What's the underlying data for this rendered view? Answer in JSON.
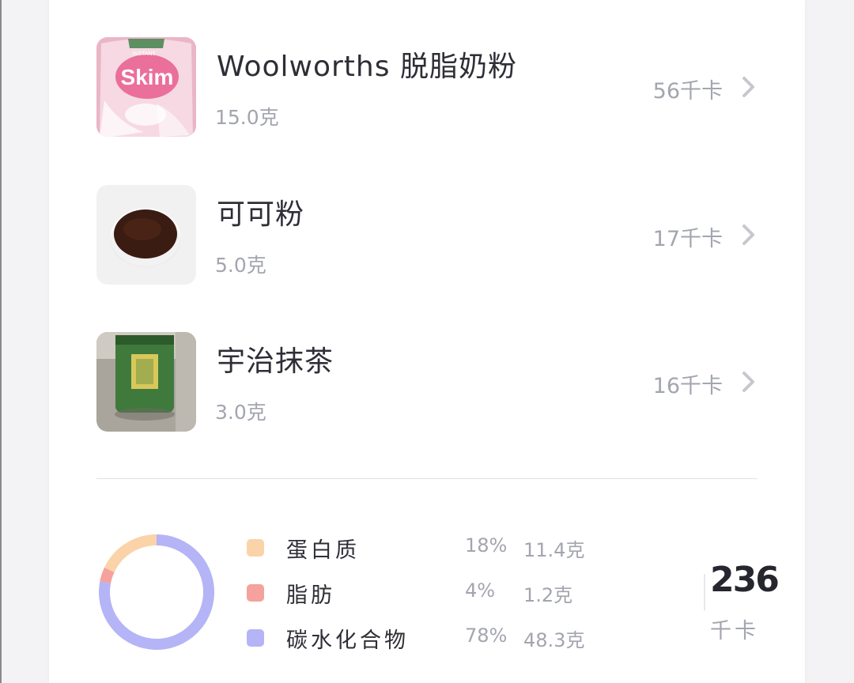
{
  "food_items": [
    {
      "name": "Woolworths 脱脂奶粉",
      "amount": "15.0克",
      "kcal": "56千卡",
      "image_icon": "skim-milk-powder-bag-image",
      "image_text": "Skim"
    },
    {
      "name": "可可粉",
      "amount": "5.0克",
      "kcal": "17千卡",
      "image_icon": "cocoa-powder-bowl-image"
    },
    {
      "name": "宇治抹茶",
      "amount": "3.0克",
      "kcal": "16千卡",
      "image_icon": "matcha-tin-image"
    }
  ],
  "macros": [
    {
      "name": "蛋白质",
      "percent": "18%",
      "grams": "11.4克",
      "color": "#fbd3a9",
      "share": 0.18
    },
    {
      "name": "脂肪",
      "percent": "4%",
      "grams": "1.2克",
      "color": "#f5a19e",
      "share": 0.04
    },
    {
      "name": "碳水化合物",
      "percent": "78%",
      "grams": "48.3克",
      "color": "#b4b4f6",
      "share": 0.78
    }
  ],
  "total": {
    "value": "236",
    "unit": "千卡"
  }
}
